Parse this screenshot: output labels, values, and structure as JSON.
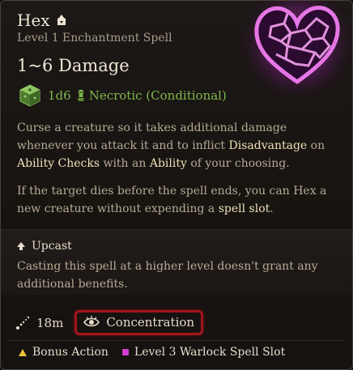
{
  "spell": {
    "name": "Hex",
    "level_school": "Level 1 Enchantment Spell",
    "damage_title": "1~6 Damage",
    "dice": "1d6",
    "damage_type": "Necrotic (Conditional)",
    "icons": {
      "name": "hand-icon",
      "dice": "d6-dice-icon",
      "damage_type": "necrotic-icon",
      "art": "hex-heart-art"
    }
  },
  "description": {
    "p1": {
      "t1": "Curse a creature so it takes additional damage whenever you attack it and to inflict ",
      "k1": "Disadvantage",
      "t2": " on ",
      "k2": "Ability Checks",
      "t3": " with an ",
      "k3": "Ability",
      "t4": " of your choosing."
    },
    "p2": {
      "t1": "If the target dies before the spell ends, you can Hex a new creature without expending a ",
      "k1": "spell slot",
      "t2": "."
    }
  },
  "upcast": {
    "title": "Upcast",
    "text": "Casting this spell at a higher level doesn't grant any additional benefits."
  },
  "properties": {
    "range": "18m",
    "concentration": "Concentration"
  },
  "cost": {
    "action": "Bonus Action",
    "slot": "Level 3 Warlock Spell Slot"
  },
  "colors": {
    "damage_green": "#7fb84e",
    "keyword": "#efe0b8",
    "concentration_border": "#a3141b",
    "bonus_action": "#e8c33a",
    "spell_slot": "#d23fcf",
    "art_glow": "#c23ad6"
  }
}
